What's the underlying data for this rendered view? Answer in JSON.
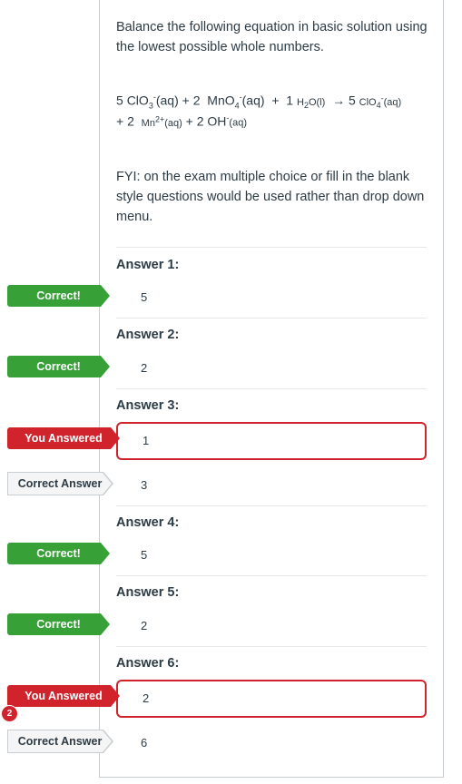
{
  "question": {
    "prompt": "Balance the following equation in basic solution using the lowest possible whole numbers.",
    "equation": {
      "c1": "5",
      "r1_base": "ClO",
      "r1_sub": "3",
      "r1_sup": "-",
      "r1_state": "(aq)",
      "plus": "+",
      "c2": "2",
      "r2_base": "MnO",
      "r2_sub": "4",
      "r2_sup": "-",
      "r2_state": "(aq)",
      "c3": "1",
      "r3_text": "H",
      "r3_sub": "2",
      "r3_tail": "O(l)",
      "arrow": "→",
      "c4": "5",
      "p1_base": "ClO",
      "p1_sub": "4",
      "p1_sup": "-",
      "p1_state": "(aq)",
      "c5": "2",
      "p2_base": "Mn",
      "p2_sup": "2+",
      "p2_state": "(aq)",
      "c6": "2",
      "p3_base": "OH",
      "p3_sup": "-",
      "p3_state": "(aq)"
    },
    "fyi": "FYI: on the exam multiple choice or fill in the blank style questions would be used rather than drop down menu."
  },
  "labels": {
    "correct": "Correct!",
    "you_answered": "You Answered",
    "correct_answer": "Correct Answer"
  },
  "answers": [
    {
      "heading": "Answer 1:",
      "value": "5"
    },
    {
      "heading": "Answer 2:",
      "value": "2"
    },
    {
      "heading": "Answer 3:",
      "your_value": "1",
      "correct_value": "3"
    },
    {
      "heading": "Answer 4:",
      "value": "5"
    },
    {
      "heading": "Answer 5:",
      "value": "2"
    },
    {
      "heading": "Answer 6:",
      "your_value": "2",
      "correct_value": "6"
    }
  ],
  "badge_count": "2",
  "colors": {
    "correct": "#37a138",
    "wrong": "#d0232b",
    "text": "#2d3b45",
    "border": "#c7cdd1"
  }
}
